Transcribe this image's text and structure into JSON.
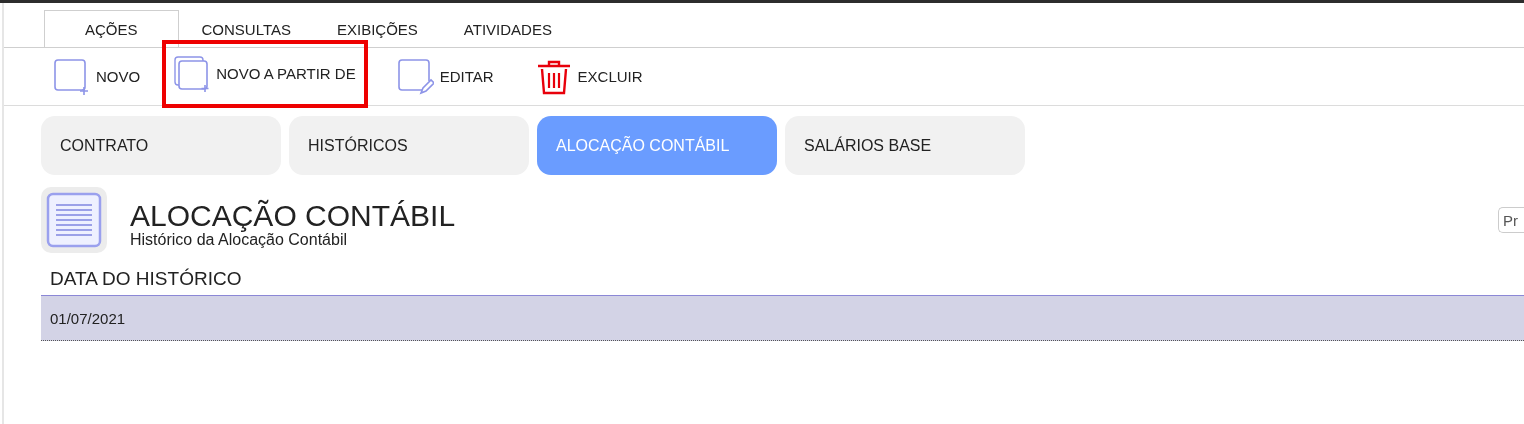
{
  "menu_tabs": [
    {
      "label": "AÇÕES",
      "selected": true
    },
    {
      "label": "CONSULTAS",
      "selected": false
    },
    {
      "label": "EXIBIÇÕES",
      "selected": false
    },
    {
      "label": "ATIVIDADES",
      "selected": false
    }
  ],
  "toolbar": [
    {
      "label": "NOVO",
      "kind": "new",
      "highlighted": false
    },
    {
      "label": "NOVO A PARTIR DE",
      "kind": "copy",
      "highlighted": true
    },
    {
      "label": "EDITAR",
      "kind": "edit",
      "highlighted": false
    },
    {
      "label": "EXCLUIR",
      "kind": "delete",
      "highlighted": false
    }
  ],
  "section_tabs": [
    {
      "label": "CONTRATO",
      "selected": false
    },
    {
      "label": "HISTÓRICOS",
      "selected": false
    },
    {
      "label": "ALOCAÇÃO CONTÁBIL",
      "selected": true
    },
    {
      "label": "SALÁRIOS BASE",
      "selected": false
    }
  ],
  "header": {
    "title": "ALOCAÇÃO CONTÁBIL",
    "subtitle": "Histórico da Alocação Contábil"
  },
  "search": {
    "placeholder": "Pr"
  },
  "table": {
    "columns": [
      "DATA DO HISTÓRICO"
    ],
    "rows": [
      {
        "cells": [
          "01/07/2021"
        ],
        "selected": true
      }
    ]
  }
}
